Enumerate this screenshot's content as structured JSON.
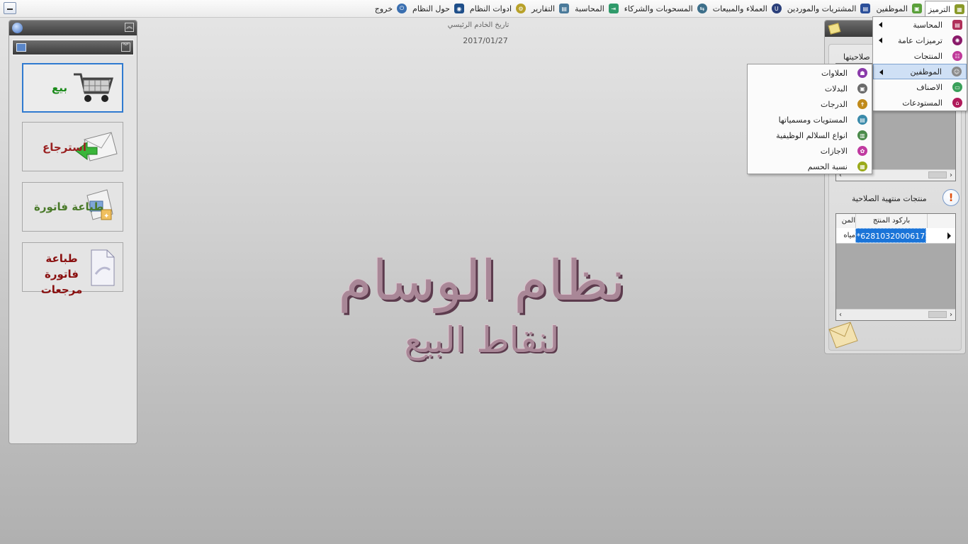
{
  "menubar": {
    "items": [
      {
        "label": "الترميز",
        "icon": "coding-icon",
        "color": "#8a9a2a"
      },
      {
        "label": "الموظفين",
        "icon": "employees-icon",
        "color": "#5aa03a"
      },
      {
        "label": "المشتريات والموردين",
        "icon": "purchases-icon",
        "color": "#2b4f9a"
      },
      {
        "label": "العملاء والمبيعات",
        "icon": "customers-icon",
        "color": "#2a3f7a"
      },
      {
        "label": "المسحوبات والشركاء",
        "icon": "withdrawals-icon",
        "color": "#3d6f8a"
      },
      {
        "label": "المحاسبة",
        "icon": "accounting-icon",
        "color": "#2f9a6a"
      },
      {
        "label": "التقارير",
        "icon": "reports-icon",
        "color": "#4a7a9a"
      },
      {
        "label": "ادوات النظام",
        "icon": "tools-icon",
        "color": "#b8a12a"
      },
      {
        "label": "حول النظام",
        "icon": "about-icon",
        "color": "#1f4f8a"
      },
      {
        "label": "خروج",
        "icon": "exit-icon",
        "color": "#3a6fb0"
      }
    ]
  },
  "left_panel": {
    "tiles": [
      {
        "label": "بيع",
        "color": "#1a8a1a",
        "icon": "shopping-cart-icon"
      },
      {
        "label": "استرجاع",
        "color": "#9a2020",
        "icon": "return-envelope-icon"
      },
      {
        "label": "طباعة فاتورة",
        "color": "#4a7a2a",
        "icon": "print-invoice-icon"
      },
      {
        "label": "طباعة فاتورة مرجعات",
        "color": "#8a1010",
        "icon": "print-returns-icon"
      }
    ]
  },
  "center": {
    "server_date_label": "تاريخ الخادم الرئيسي",
    "server_date": "2017/01/27",
    "logo_line1": "نظام الوسام",
    "logo_line2": "لنقاط البيع"
  },
  "right_panel": {
    "partial_title": "صلاحيتها",
    "expired_label": "منتجات منتهية الصلاحية",
    "col_barcode": "باركود المنتج",
    "col_product": "المن",
    "row_barcode": "*6281032000617",
    "row_product": "مياه"
  },
  "coding_menu": {
    "items": [
      {
        "label": "المحاسبة",
        "submenu": true,
        "color": "#b0305a"
      },
      {
        "label": "ترميزات عامة",
        "submenu": true,
        "color": "#8a1a6a"
      },
      {
        "label": "المنتجات",
        "submenu": false,
        "color": "#c03a9a"
      },
      {
        "label": "الموظفين",
        "submenu": true,
        "color": "#8a8a8a",
        "highlighted": true
      },
      {
        "label": "الاصناف",
        "submenu": false,
        "color": "#3aa05a"
      },
      {
        "label": "المستودعات",
        "submenu": false,
        "color": "#b01a5a"
      }
    ]
  },
  "employees_submenu": {
    "items": [
      {
        "label": "العلاوات",
        "color": "#8a3aaa"
      },
      {
        "label": "البدلات",
        "color": "#6a6a6a"
      },
      {
        "label": "الدرجات",
        "color": "#c08a1a"
      },
      {
        "label": "المستويات ومسمياتها",
        "color": "#3a8aaa"
      },
      {
        "label": "انواع السلالم الوظيفية",
        "color": "#4a8a4a"
      },
      {
        "label": "الاجازات",
        "color": "#c03aa0"
      },
      {
        "label": "نسبة الحسم",
        "color": "#9aaa1a"
      }
    ]
  }
}
